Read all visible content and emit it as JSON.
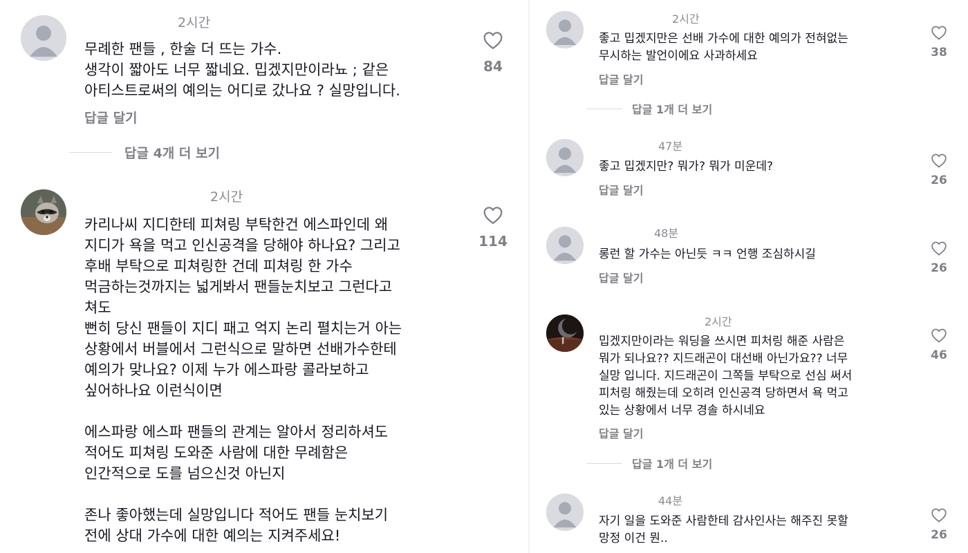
{
  "ui": {
    "reply_label": "답글 달기"
  },
  "left_comments": [
    {
      "time": "2시간",
      "avatar": "default-avatar",
      "text": "무례한 팬들 , 한술 더 뜨는 가수.\n생각이 짧아도 너무 짧네요. 밉겠지만이라뇨 ; 같은\n아티스트로써의 예의는 어디로 갔나요 ? 실망입니다.",
      "likes": "84",
      "more_replies": "답글 4개 더 보기"
    },
    {
      "time": "2시간",
      "avatar": "raccoon-avatar",
      "text": "카리나씨 지디한테 피쳐링 부탁한건 에스파인데 왜\n지디가 욕을 먹고 인신공격을 당해야 하나요? 그리고\n후배 부탁으로 피쳐링한 건데 피쳐링 한 가수\n먹금하는것까지는 넓게봐서 팬들눈치보고 그런다고\n쳐도\n뻔히 당신 팬들이 지디 패고 억지 논리 펼치는거 아는\n상황에서 버블에서 그런식으로 말하면 선배가수한테\n예의가 맞나요? 이제 누가 에스파랑 콜라보하고\n싶어하나요 이런식이면\n\n에스파랑 에스파 팬들의 관계는 알아서 정리하셔도\n적어도 피쳐링 도와준 사람에 대한 무례함은\n인간적으로 도를 넘으신것 아닌지\n\n존나 좋아했는데 실망입니다 적어도 팬들 눈치보기\n전에 상대 가수에 대한 예의는 지켜주세요!",
      "likes": "114"
    }
  ],
  "right_comments": [
    {
      "time": "2시간",
      "avatar": "default-avatar",
      "text": "좋고 밉겠지만은 선배 가수에 대한 예의가 전혀없는\n무시하는 발언이에요 사과하세요",
      "likes": "38",
      "more_replies": "답글 1개 더 보기"
    },
    {
      "time": "47분",
      "avatar": "default-avatar",
      "text": "좋고 밉겠지만? 뭐가? 뭐가 미운데?",
      "likes": "26"
    },
    {
      "time": "48분",
      "avatar": "default-avatar",
      "text": "롱런 할 가수는 아닌듯 ㅋㅋ 언행 조심하시길",
      "likes": "26"
    },
    {
      "time": "2시간",
      "avatar": "moon-photo-avatar",
      "text": "밉겠지만이라는 워딩을 쓰시면 피처링 해준 사람은\n뭐가 되나요?? 지드래곤이 대선배 아닌가요?? 너무\n실망 입니다. 지드래곤이 그쪽들 부탁으로 선심 써서\n피처링 해줬는데 오히려 인신공격 당하면서 욕 먹고\n있는 상황에서 너무 경솔 하시네요",
      "likes": "46",
      "more_replies": "답글 1개 더 보기"
    },
    {
      "time": "44분",
      "avatar": "default-avatar",
      "text": "자기 일을 도와준 사람한테 감사인사는 해주진 못할\n망정 이건 뭔..",
      "likes": "26"
    }
  ],
  "colors": {
    "text": "#161823",
    "muted": "#7f8087",
    "timestamp": "#8a8b91",
    "avatar_bg": "#d9dbe0",
    "avatar_figure": "#a7abb5"
  }
}
